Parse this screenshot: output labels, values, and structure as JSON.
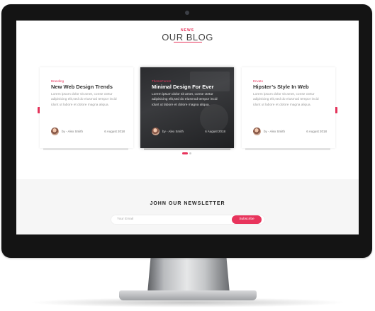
{
  "blog": {
    "kicker": "NEWS",
    "title": "OUR BLOG"
  },
  "cards": [
    {
      "category": "Branding",
      "title": "New Web Design Trends",
      "excerpt": "Lorem ipsum dolor sit amet, conse ctetur adipisicing elit,sed do eiusmod tempor incid idunt ut labore et dolore magna aliqua.",
      "author": "by - Alex Smith",
      "date": "6 August 2018"
    },
    {
      "category": "ThemeForest",
      "title": "Minimal Design For Ever",
      "excerpt": "Lorem ipsum dolor sit amet, conse ctetur adipisicing elit,sed do eiusmod tempor incid idunt ut labore et dolore magna aliqua.",
      "author": "by - Alex Smith",
      "date": "6 August 2018"
    },
    {
      "category": "Envato",
      "title": "Hipster’s Style In Web",
      "excerpt": "Lorem ipsum dolor sit amet, conse ctetur adipisicing elit,sed do eiusmod tempor incid idunt ut labore et dolore magna aliqua.",
      "author": "by - Alex Smith",
      "date": "6 August 2018"
    }
  ],
  "carousel": {
    "prev_icon": "chevron-left-icon",
    "next_icon": "chevron-right-icon",
    "prev_glyph": "‹",
    "next_glyph": "›",
    "active_index": 0,
    "dot_count": 2
  },
  "newsletter": {
    "title": "JOHN OUR NEWSLETTER",
    "placeholder": "Your Email",
    "button_label": "Subscribe"
  },
  "colors": {
    "accent": "#e8345c",
    "bezel": "#141414",
    "newsletter_bg": "#f6f6f6"
  }
}
